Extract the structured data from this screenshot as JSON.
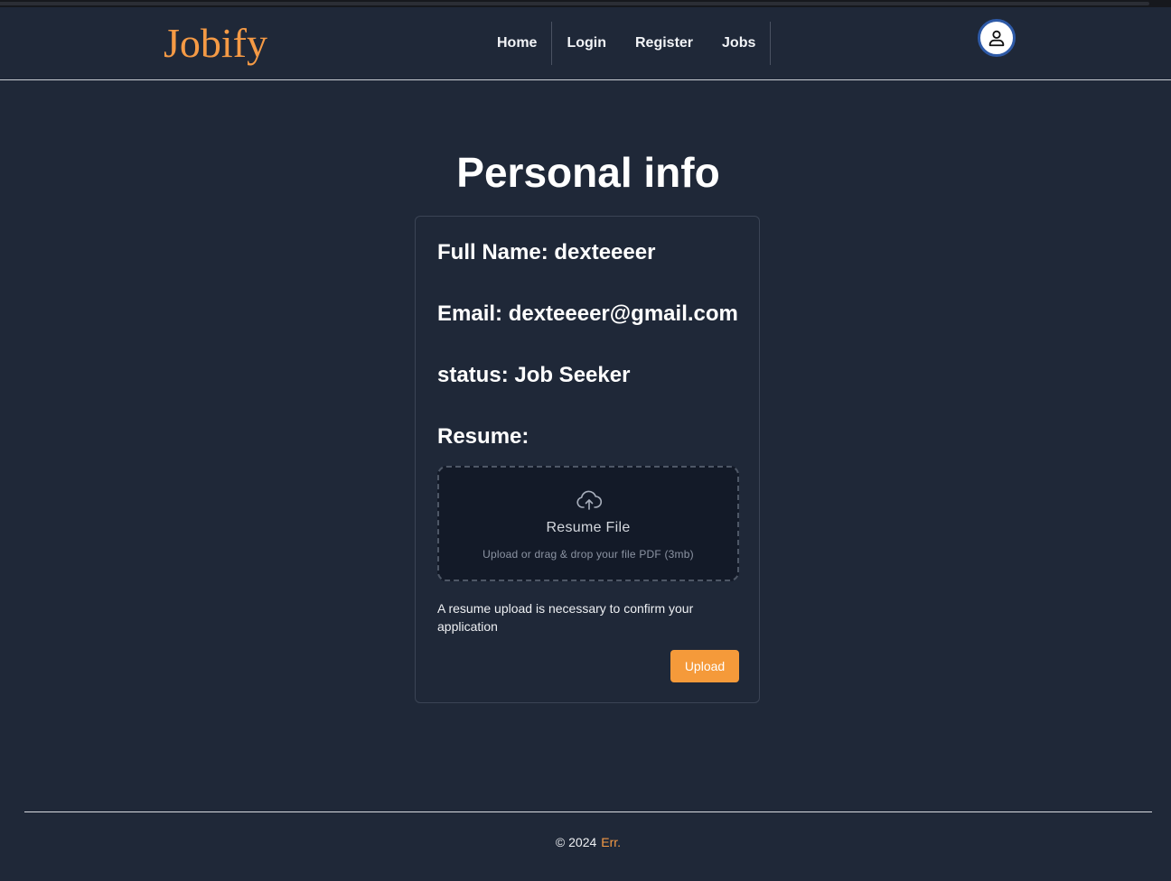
{
  "nav": {
    "logo": "Jobify",
    "links": [
      "Home",
      "Login",
      "Register",
      "Jobs"
    ]
  },
  "page": {
    "title": "Personal info"
  },
  "profile": {
    "full_name": "Full Name: dexteeeer",
    "email": "Email: dexteeeer@gmail.com",
    "status": "status: Job Seeker",
    "resume_label": "Resume:"
  },
  "dropzone": {
    "icon": "cloud-upload-icon",
    "title": "Resume File",
    "subtitle": "Upload or drag & drop your file PDF (3mb)"
  },
  "note": "A resume upload is necessary to confirm your application",
  "upload_button": "Upload",
  "footer": {
    "copyright": "© 2024",
    "brand": "Err."
  },
  "colors": {
    "background": "#1f2838",
    "accent": "#f59a3a",
    "dropzone_bg": "#131a28",
    "avatar_ring": "#2e5aa7"
  }
}
